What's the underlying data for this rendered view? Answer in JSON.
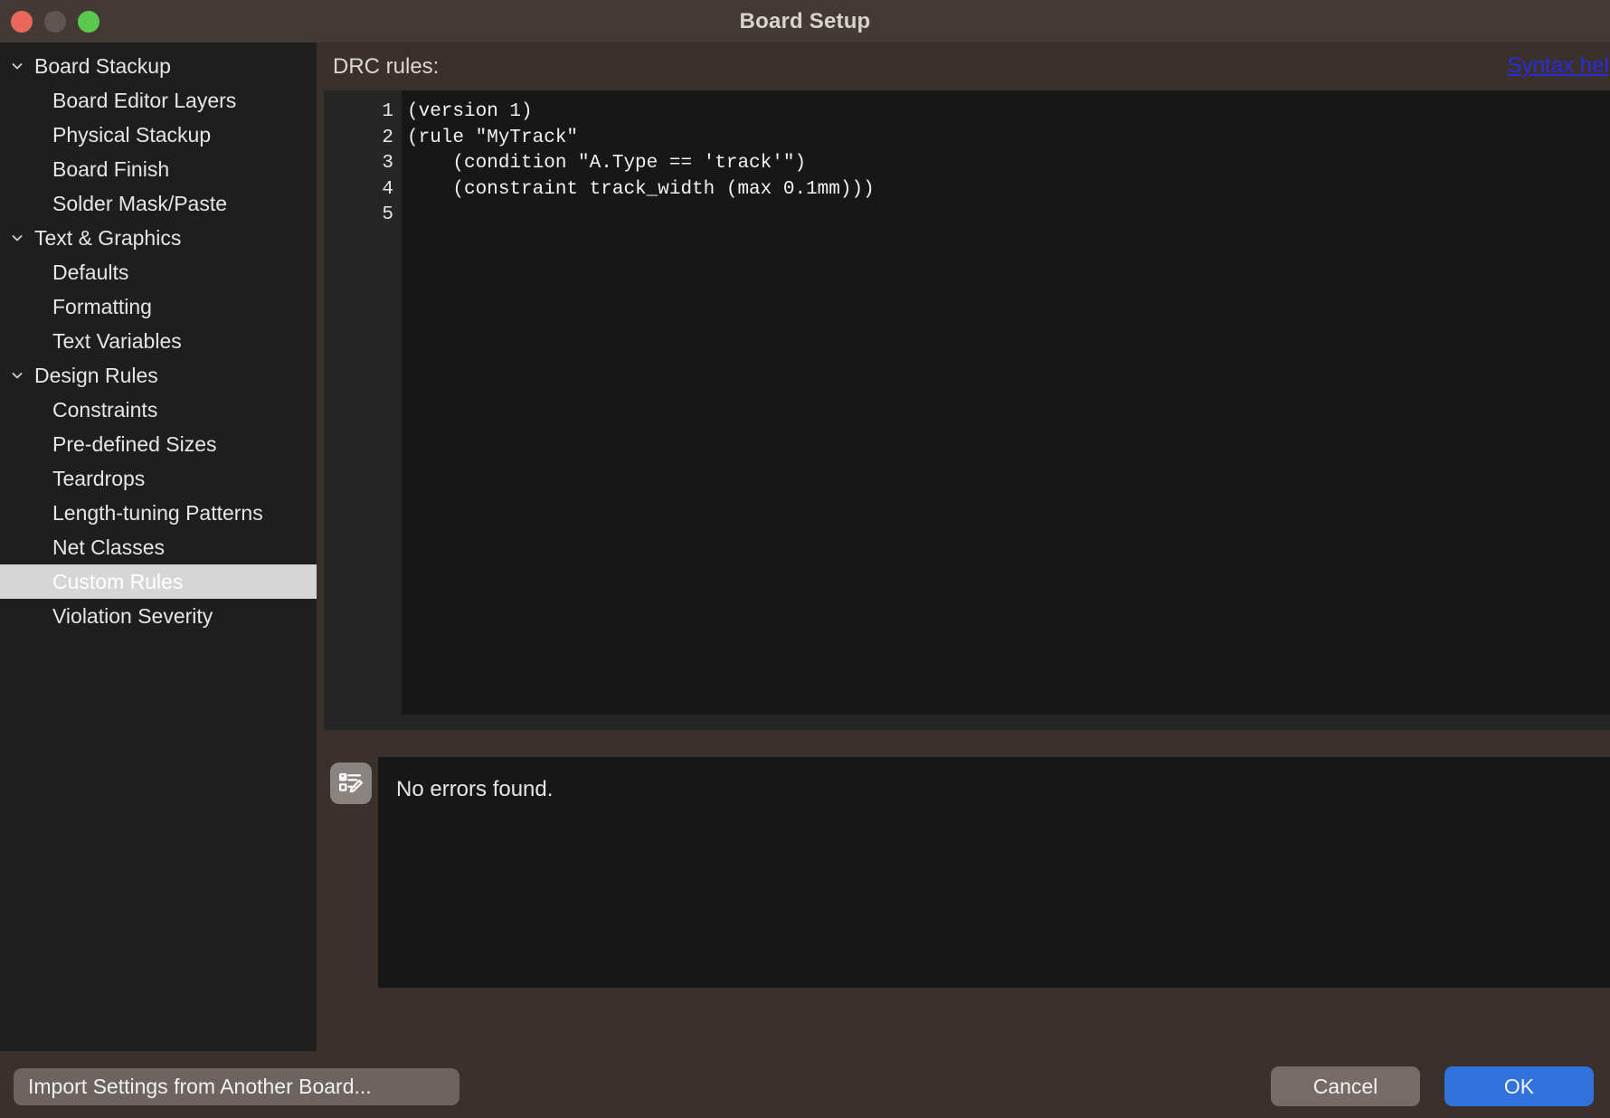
{
  "window": {
    "title": "Board Setup",
    "traffic_lights": [
      {
        "name": "close-button",
        "color": "#e8695c"
      },
      {
        "name": "minimize-button",
        "color": "#5f5551"
      },
      {
        "name": "maximize-button",
        "color": "#5bc94c"
      }
    ]
  },
  "sidebar": {
    "items": [
      {
        "label": "Board Stackup",
        "type": "group",
        "icon": "chevron-down-icon",
        "selected": false
      },
      {
        "label": "Board Editor Layers",
        "type": "child",
        "icon": "",
        "selected": false
      },
      {
        "label": "Physical Stackup",
        "type": "child",
        "icon": "",
        "selected": false
      },
      {
        "label": "Board Finish",
        "type": "child",
        "icon": "",
        "selected": false
      },
      {
        "label": "Solder Mask/Paste",
        "type": "child",
        "icon": "",
        "selected": false
      },
      {
        "label": "Text & Graphics",
        "type": "group",
        "icon": "chevron-down-icon",
        "selected": false
      },
      {
        "label": "Defaults",
        "type": "child",
        "icon": "",
        "selected": false
      },
      {
        "label": "Formatting",
        "type": "child",
        "icon": "",
        "selected": false
      },
      {
        "label": "Text Variables",
        "type": "child",
        "icon": "",
        "selected": false
      },
      {
        "label": "Design Rules",
        "type": "group",
        "icon": "chevron-down-icon",
        "selected": false
      },
      {
        "label": "Constraints",
        "type": "child",
        "icon": "",
        "selected": false
      },
      {
        "label": "Pre-defined Sizes",
        "type": "child",
        "icon": "",
        "selected": false
      },
      {
        "label": "Teardrops",
        "type": "child",
        "icon": "",
        "selected": false
      },
      {
        "label": "Length-tuning Patterns",
        "type": "child",
        "icon": "",
        "selected": false
      },
      {
        "label": "Net Classes",
        "type": "child",
        "icon": "",
        "selected": false
      },
      {
        "label": "Custom Rules",
        "type": "child",
        "icon": "",
        "selected": true
      },
      {
        "label": "Violation Severity",
        "type": "child",
        "icon": "",
        "selected": false
      }
    ]
  },
  "main": {
    "drc_label": "DRC rules:",
    "syntax_help_label": "Syntax help",
    "syntax_help_color": "#2b2be0",
    "editor": {
      "line_numbers": [
        "1",
        "2",
        "3",
        "4",
        "5"
      ],
      "lines": [
        "(version 1)",
        "(rule \"MyTrack\"",
        "    (condition \"A.Type == 'track'\")",
        "    (constraint track_width (max 0.1mm)))",
        ""
      ]
    },
    "status": {
      "icon": "checklist-edit-icon",
      "message": "No errors found."
    }
  },
  "footer": {
    "import_label": "Import Settings from Another Board...",
    "cancel_label": "Cancel",
    "ok_label": "OK",
    "ok_color": "#3272dd"
  }
}
